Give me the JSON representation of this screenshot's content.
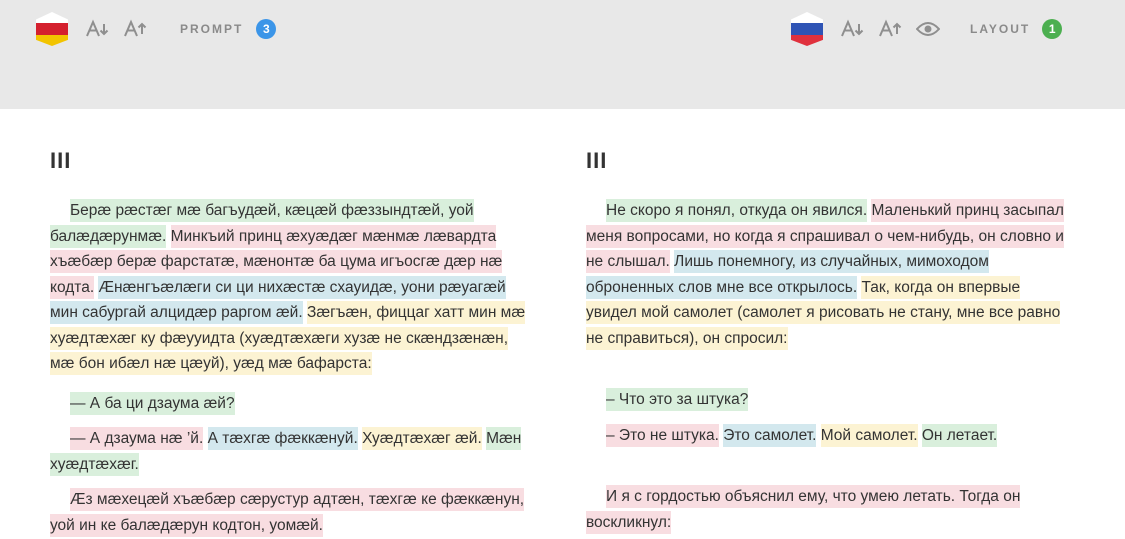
{
  "colors": {
    "toolbar_bg": "#e8e8e8",
    "badge_blue": "#3b95e8",
    "badge_green": "#4caf50",
    "highlight_green": "#d9efdc",
    "highlight_pink": "#f8dde1",
    "highlight_blue": "#d3e8ee",
    "highlight_yellow": "#fcf3d3"
  },
  "left_toolbar": {
    "flag": "north-ossetia-flag",
    "flag_colors": [
      "#ffffff",
      "#d4202e",
      "#f2c400"
    ],
    "font_decrease_icon": "font-decrease-icon",
    "font_increase_icon": "font-increase-icon",
    "label": "PROMPT",
    "badge": "3"
  },
  "right_toolbar": {
    "flag": "russia-flag",
    "flag_colors": [
      "#ffffff",
      "#2f54b5",
      "#e0313d"
    ],
    "font_decrease_icon": "font-decrease-icon",
    "font_increase_icon": "font-increase-icon",
    "eye_icon": "eye-icon",
    "label": "LAYOUT",
    "badge": "1"
  },
  "left_column": {
    "chapter": "III",
    "paragraphs": [
      [
        {
          "text": "Берæ рæстæг мæ багъудæй, кæцæй фæззындтæй, уой балæдæрунмæ.",
          "color": "g"
        },
        {
          "text": "Минкъий принц æхуæдæг мæнмæ лæвардта хъæбæр берæ фарстатæ, мæнонтæ ба цума игъосгæ дæр нæ кодта.",
          "color": "p"
        },
        {
          "text": "Æнæнгъæлæги си ци нихæстæ схауидæ, уони рæуагæй мин сабургай алцидæр раргом æй.",
          "color": "b"
        },
        {
          "text": "Зæгъæн, фиццаг хатт мин мæ хуæдтæхæг ку фæууидта (хуæдтæхæги хузæ не скæндзæнæн, мæ бон ибæл нæ цæуй), уæд мæ бафарста:",
          "color": "y"
        }
      ],
      [
        {
          "text": "— А ба ци дзаума æй?",
          "color": "g"
        }
      ],
      [
        {
          "text": "— А дзаума нæ ’й.",
          "color": "p"
        },
        {
          "text": "А тæхгæ фæккæнуй.",
          "color": "b"
        },
        {
          "text": "Хуæдтæхæг æй.",
          "color": "y"
        },
        {
          "text": "Мæн хуæдтæхæг.",
          "color": "g"
        }
      ],
      [
        {
          "text": "Æз мæхецæй хъæбæр сæрустур адтæн, тæхгæ ке фæккæнун, уой ин ке балæдæрун кодтон, уомæй.",
          "color": "p"
        }
      ]
    ]
  },
  "right_column": {
    "chapter": "III",
    "paragraphs": [
      [
        {
          "text": "Не скоро я понял, откуда он явился.",
          "color": "g"
        },
        {
          "text": "Маленький принц засыпал меня вопросами, но когда я спрашивал о чем-нибудь, он словно и не слышал.",
          "color": "p"
        },
        {
          "text": "Лишь понемногу, из случайных, мимоходом оброненных слов мне все открылось.",
          "color": "b"
        },
        {
          "text": "Так, когда он впервые увидел мой самолет (самолет я рисовать не стану, мне все равно не справиться), он спросил:",
          "color": "y"
        }
      ],
      [
        {
          "text": "– Что это за штука?",
          "color": "g"
        }
      ],
      [
        {
          "text": "– Это не штука.",
          "color": "p"
        },
        {
          "text": "Это самолет.",
          "color": "b"
        },
        {
          "text": "Мой самолет.",
          "color": "y"
        },
        {
          "text": "Он летает.",
          "color": "g"
        }
      ],
      [
        {
          "text": "И я с гордостью объяснил ему, что умею летать. Тогда он воскликнул:",
          "color": "p"
        }
      ]
    ]
  }
}
